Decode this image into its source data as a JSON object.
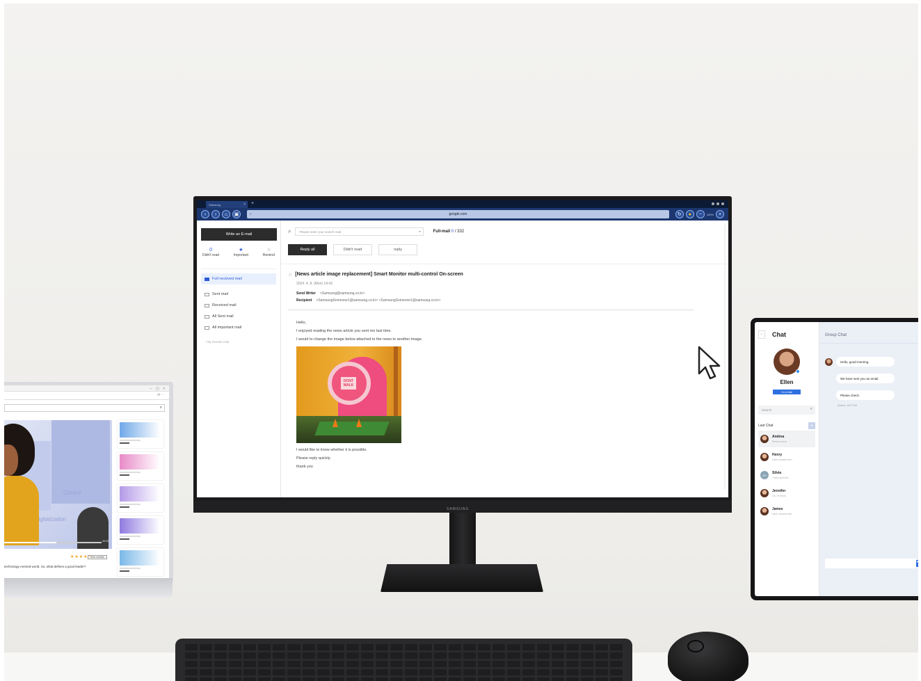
{
  "monitor": {
    "brand": "SAMSUNG",
    "browser": {
      "tab_title": "Samsung",
      "tab_close": "×",
      "new_tab": "+",
      "url": "google.com",
      "zoom": "100%"
    }
  },
  "mail": {
    "compose_label": "Write an E-mail",
    "quick": [
      {
        "icon": "0",
        "label": "Didn't read"
      },
      {
        "icon": "★",
        "label": "Important"
      },
      {
        "icon": "☆",
        "label": "Remind"
      }
    ],
    "folders": [
      {
        "label": "Full received mail",
        "active": true
      },
      {
        "label": "Sent mail"
      },
      {
        "label": "Received mail"
      },
      {
        "label": "All Sent mail"
      },
      {
        "label": "All important mail"
      }
    ],
    "favorite_label": "My favorite mail",
    "search_placeholder": "Please enter your search mail.",
    "count_label": "Full-mail",
    "count_current": "0",
    "count_total": "/ 332",
    "filters": [
      "Reply all",
      "Didn't read",
      "reply"
    ],
    "subject": "[News article image replacement] Smart Monitor multi-control On-screen",
    "date": "2024. 4. 8. (Mon) 14:43",
    "send_writer_label": "Send Writer",
    "send_writer": "<Samsung@samsung.co.kr>",
    "recipient_label": "Recipient",
    "recipient": "<SamsungSomeone1@samsung.co.kr> <SamsungSomeone1@samsung.co.kr>",
    "body_top": [
      "Hello,",
      "I enjoyed reading the news article you sent me last time.",
      "I would to change the image below attached to the news to another image."
    ],
    "image_sign": "DONT WALK",
    "body_bottom": [
      "I would like to know whether it is possible.",
      "Please reply quickly.",
      "thank you"
    ]
  },
  "laptop": {
    "video_word_1": "Control",
    "video_word_2": "digitalization",
    "video_time": "41:07",
    "rating": "★★★★☆",
    "button_label": "View website",
    "title_text": "technology-centred world. So, what defines a good leader?",
    "card_colors": [
      "#6fa8e8",
      "#e88ac8",
      "#b49ae8",
      "#8f7ae0",
      "#7ab8e8"
    ]
  },
  "tablet": {
    "title": "Chat",
    "user_name": "Ellen",
    "go_to_mail": "Go to Mail",
    "search_placeholder": "Search",
    "last_chat_label": "Last Chat",
    "contacts": [
      {
        "name": "Andrea",
        "msg": "Please check.",
        "selected": true
      },
      {
        "name": "Henry",
        "msg": "Have checked the..."
      },
      {
        "name": "Silvia",
        "msg": "I have sent the...",
        "initials": "SV"
      },
      {
        "name": "Jennifer",
        "msg": "Ok, I'll check."
      },
      {
        "name": "James",
        "msg": "Have checked the..."
      }
    ],
    "group_chat_label": "Group Chat",
    "messages": [
      "Hello, good morning.",
      "We have sent you an email.",
      "Please check."
    ],
    "message_time": "Andrea, 10:07 AM"
  }
}
